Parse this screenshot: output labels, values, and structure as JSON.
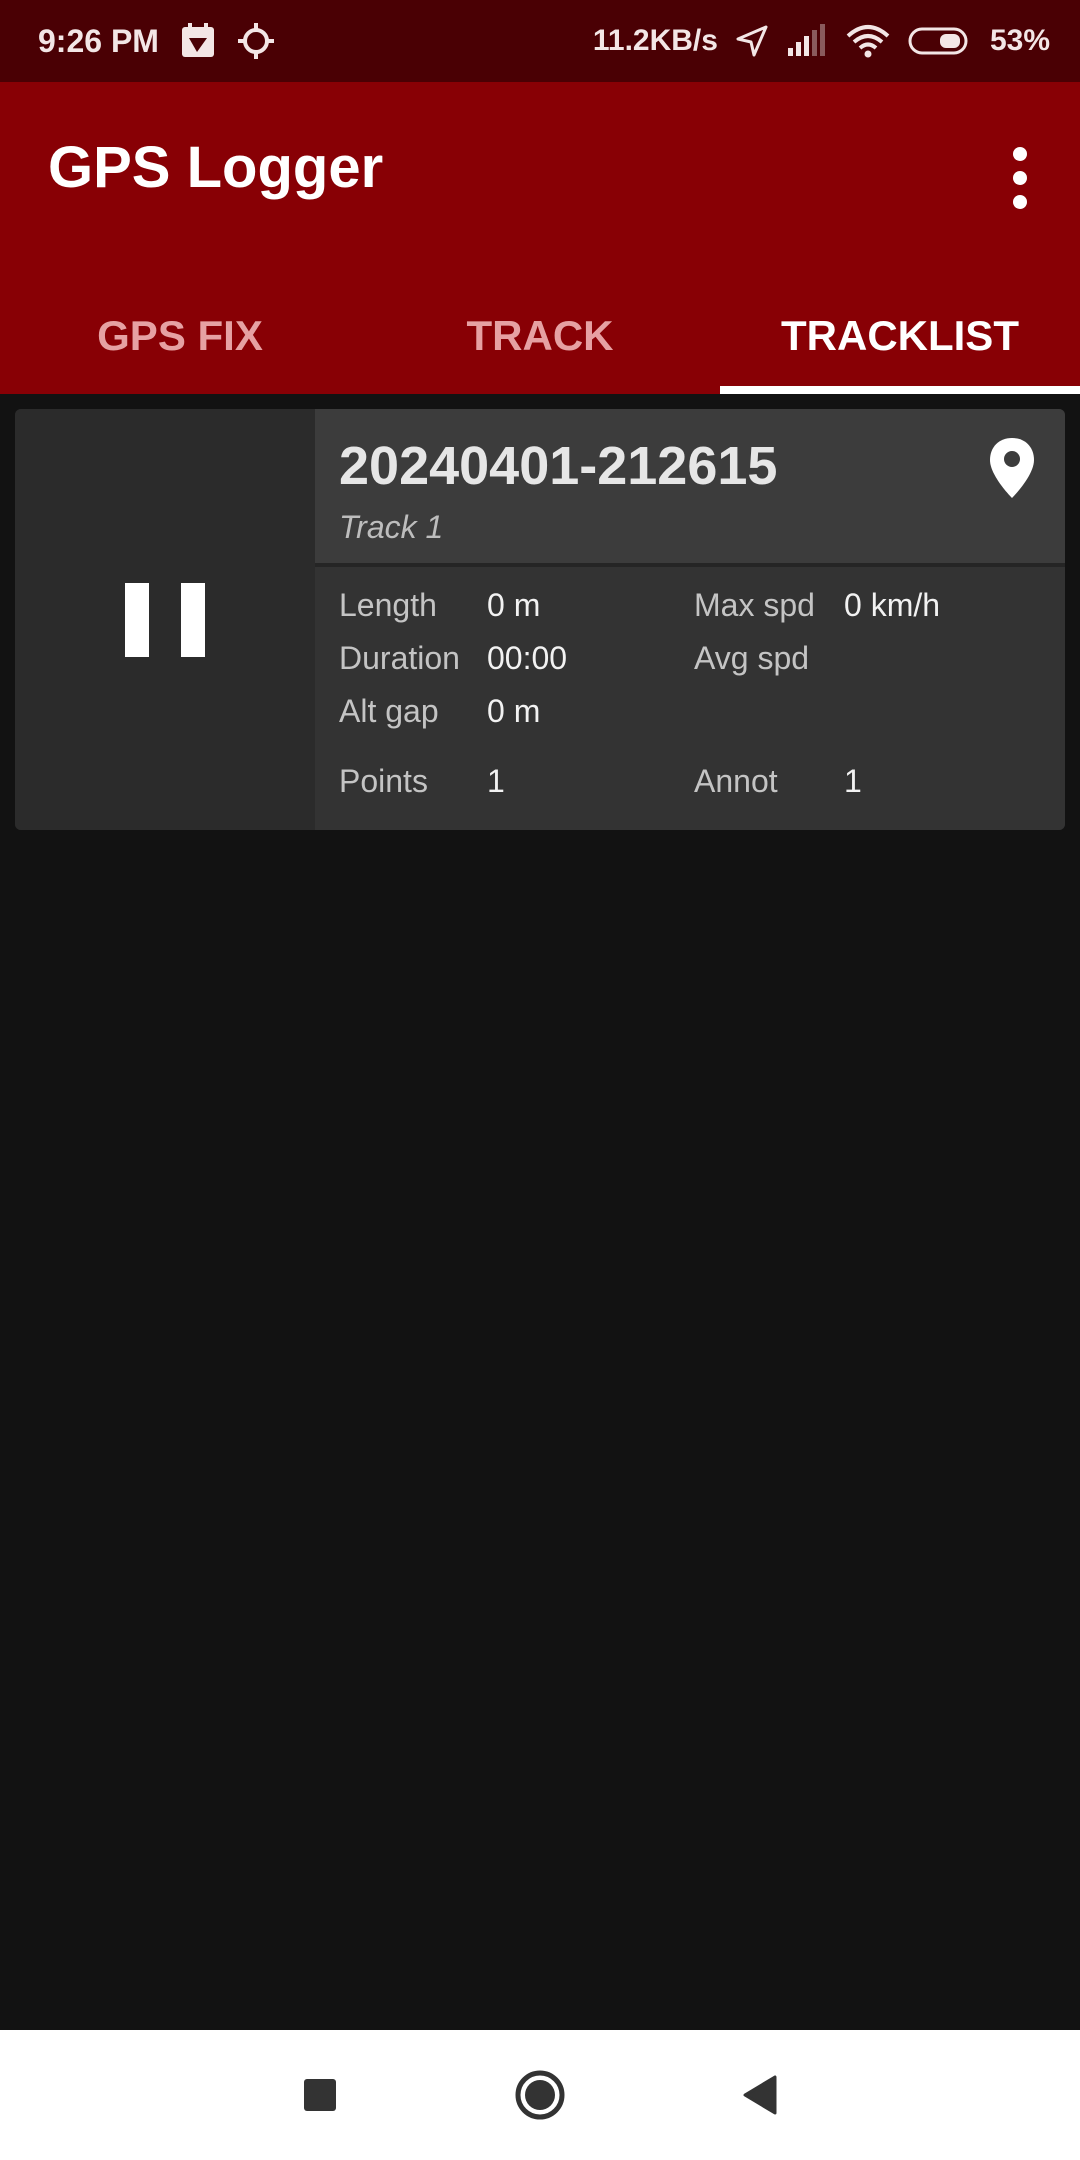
{
  "status_bar": {
    "time": "9:26 PM",
    "net_speed": "11.2KB/s",
    "battery": "53%",
    "icons": [
      "calendar-icon",
      "gps-target-icon",
      "location-arrow-icon",
      "signal-icon",
      "wifi-icon",
      "battery-icon"
    ]
  },
  "app": {
    "title": "GPS Logger",
    "overflow_icon": "more-vert-icon"
  },
  "tabs": [
    {
      "label": "GPS FIX",
      "active": false
    },
    {
      "label": "TRACK",
      "active": false
    },
    {
      "label": "TRACKLIST",
      "active": true
    }
  ],
  "track": {
    "name": "20240401-212615",
    "description": "Track 1",
    "state_icon": "pause-icon",
    "map_icon": "map-pin-icon",
    "stats": {
      "length_label": "Length",
      "length_value": "0 m",
      "duration_label": "Duration",
      "duration_value": "00:00",
      "altgap_label": "Alt gap",
      "altgap_value": "0 m",
      "points_label": "Points",
      "points_value": "1",
      "maxspd_label": "Max spd",
      "maxspd_value": "0 km/h",
      "avgspd_label": "Avg spd",
      "avgspd_value": "",
      "annot_label": "Annot",
      "annot_value": "1"
    }
  },
  "nav": {
    "recents_icon": "square-icon",
    "home_icon": "circle-icon",
    "back_icon": "triangle-back-icon"
  },
  "colors": {
    "status_bar": "#4a0004",
    "app_bar": "#880005",
    "background": "#121212",
    "card": "#2e2e2e"
  }
}
